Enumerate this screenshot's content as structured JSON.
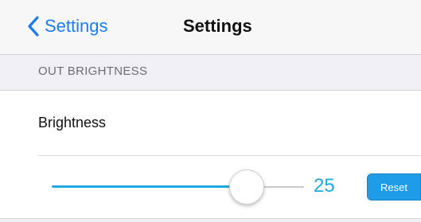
{
  "navbar": {
    "back_label": "Settings",
    "title": "Settings",
    "back_icon": "chevron-left-icon"
  },
  "section": {
    "header": "OUT BRIGHTNESS"
  },
  "brightness_cell": {
    "label": "Brightness"
  },
  "slider": {
    "value": "25",
    "fill_fraction": 0.75
  },
  "reset_button": {
    "label": "Reset"
  },
  "colors": {
    "accent": "#1a7cf2",
    "slider": "#20a8e0",
    "button": "#1e9ce8"
  }
}
